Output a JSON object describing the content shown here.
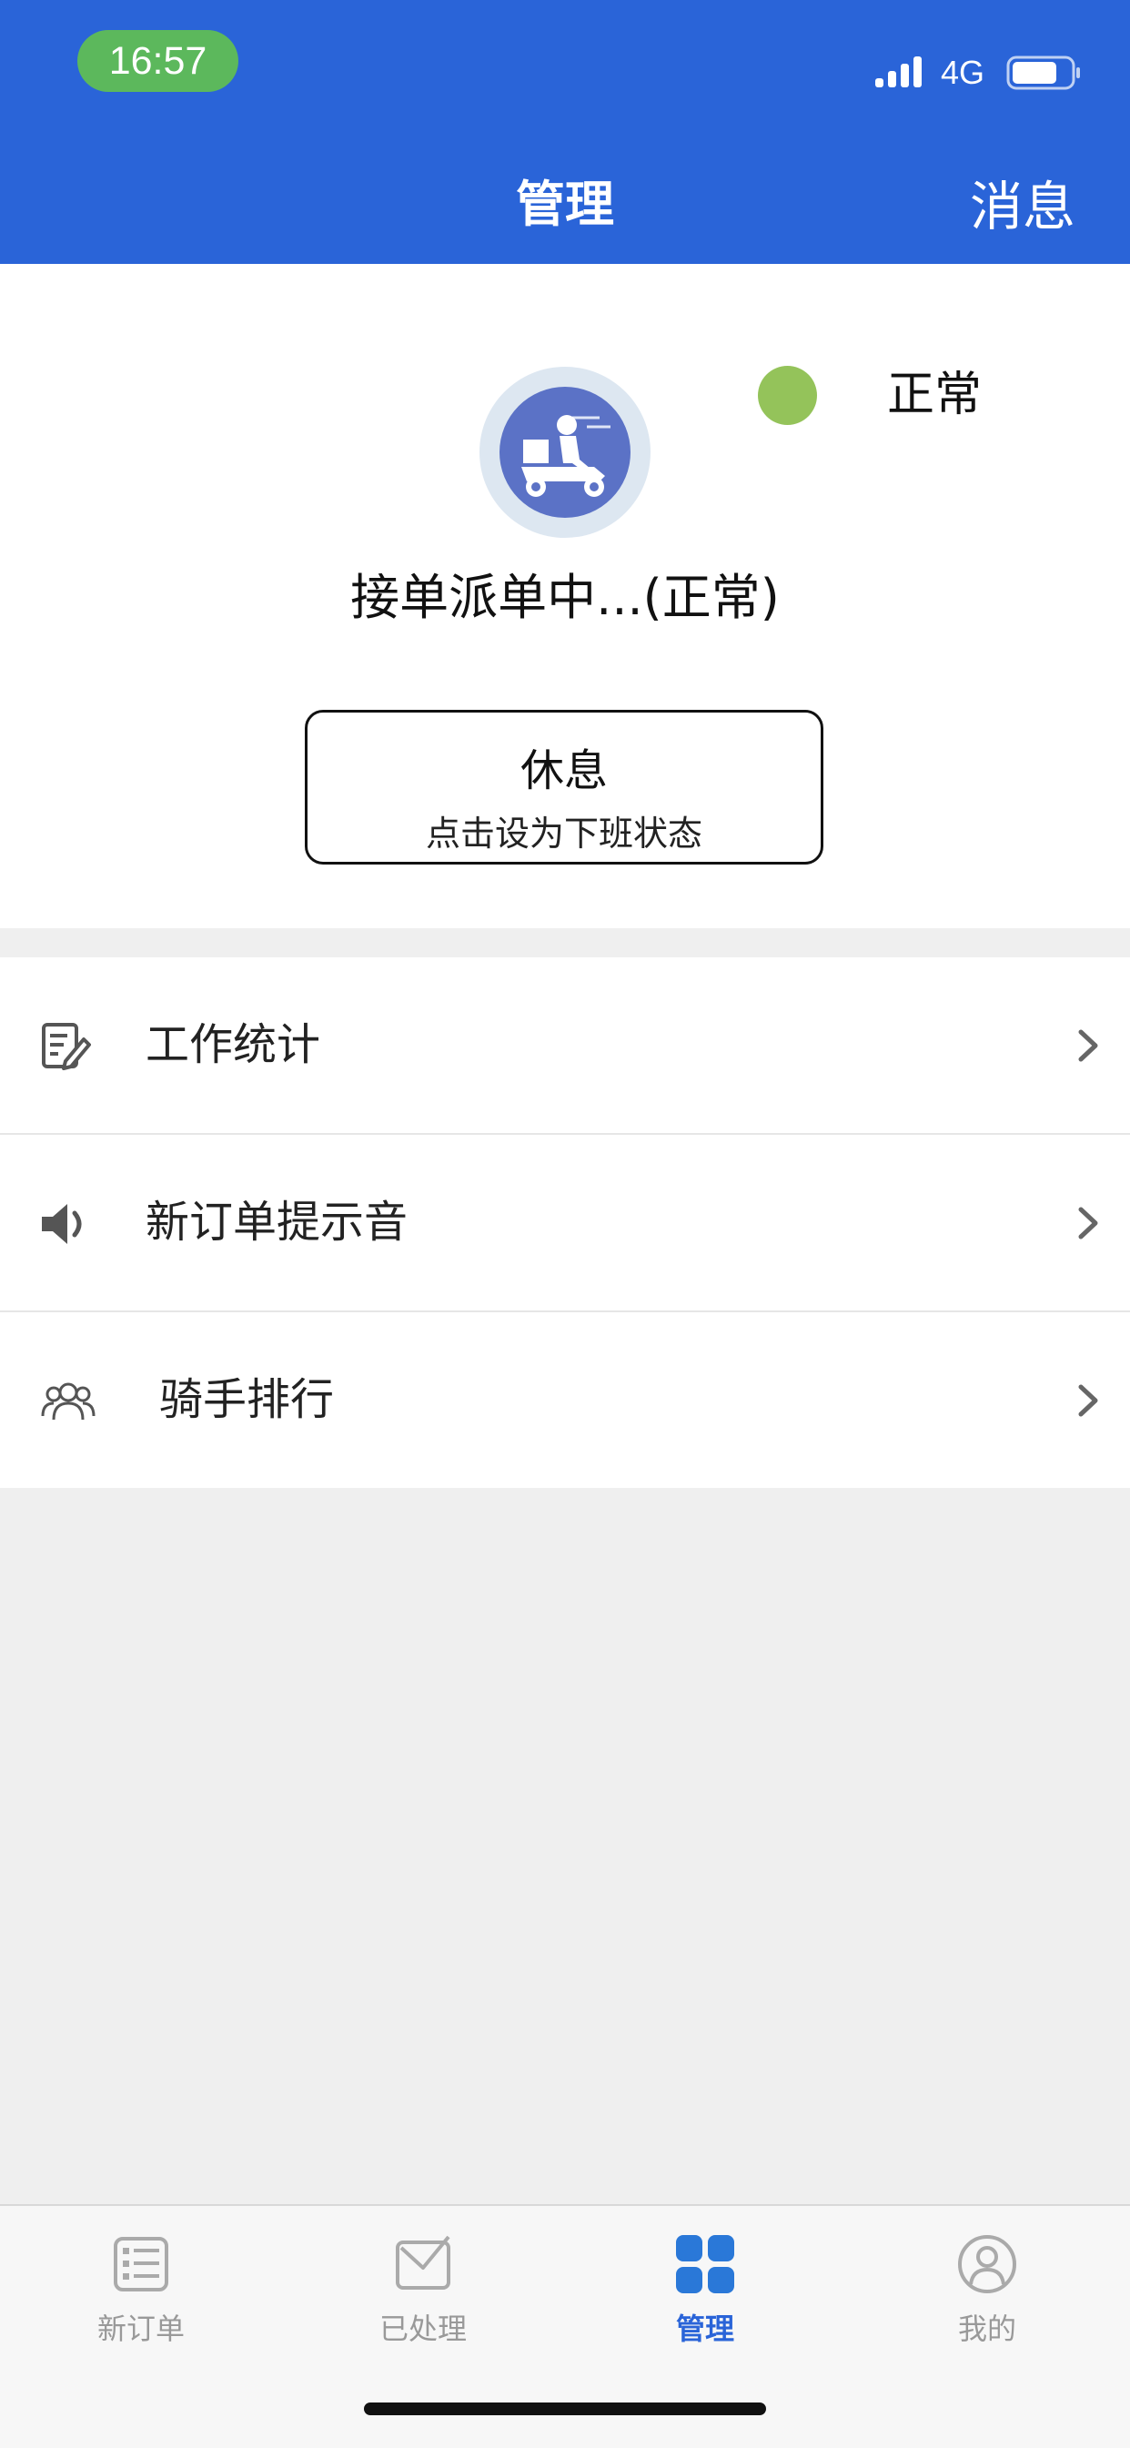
{
  "status_bar": {
    "time": "16:57",
    "network": "4G"
  },
  "header": {
    "title": "管理",
    "message_label": "消息"
  },
  "status_card": {
    "status_label": "正常",
    "status_color": "#94c35a",
    "working_text": "接单派单中...(正常)",
    "rest_button": {
      "title": "休息",
      "subtitle": "点击设为下班状态"
    }
  },
  "menu": {
    "items": [
      {
        "label": "工作统计",
        "icon": "edit-document-icon"
      },
      {
        "label": "新订单提示音",
        "icon": "speaker-icon"
      },
      {
        "label": "骑手排行",
        "icon": "users-icon"
      }
    ]
  },
  "bottom_nav": {
    "items": [
      {
        "label": "新订单",
        "icon": "list-icon",
        "active": false
      },
      {
        "label": "已处理",
        "icon": "mail-check-icon",
        "active": false
      },
      {
        "label": "管理",
        "icon": "grid-icon",
        "active": true
      },
      {
        "label": "我的",
        "icon": "profile-icon",
        "active": false
      }
    ]
  },
  "colors": {
    "primary": "#2a64d8",
    "time_pill": "#5cb85c",
    "inactive_nav": "#999999"
  }
}
